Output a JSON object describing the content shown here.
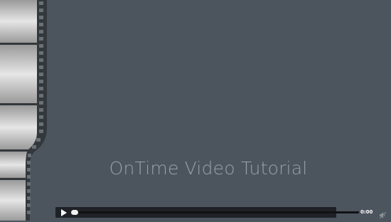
{
  "video": {
    "title": "OnTime Video Tutorial"
  },
  "player": {
    "time": "0:00",
    "progress_fraction": 0,
    "play_icon": "play-icon",
    "mute_icon": "muted-speaker-icon",
    "accent_color": "#4c555e",
    "controls_bg": "#1e2226"
  }
}
